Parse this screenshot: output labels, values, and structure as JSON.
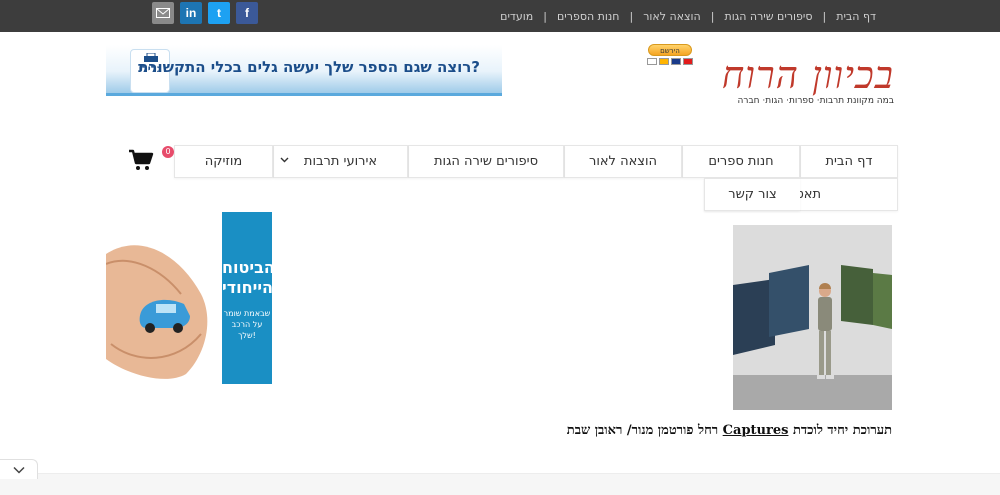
{
  "topbar": {
    "nav": [
      "דף הבית",
      "סיפורים שירה הגות",
      "הוצאה לאור",
      "חנות הספרים",
      "מועדים"
    ],
    "separator": "|",
    "social": {
      "mail_icon": "envelope-icon",
      "linkedin_label": "in",
      "twitter_label": "t",
      "facebook_label": "f",
      "colors": {
        "mail": "#8a8a8a",
        "linkedin": "#1d75b3",
        "twitter": "#1da1f2",
        "facebook": "#3b5998"
      }
    },
    "background": "#3d3d3d"
  },
  "header": {
    "logo_title": "בכיוון הרוח",
    "logo_subtitle": "במה מקוונת תרבות· ספרות· הגות· חברה",
    "logo_color": "#c0392b",
    "paypal_label": "הירשם",
    "banner_text": "רוצה שגם הספר שלך יעשה גלים בכלי התקשורת?",
    "banner_logo_text": "גלילי"
  },
  "mainnav": {
    "items": [
      "דף הבית",
      "חנות ספרים",
      "הוצאה לאור",
      "סיפורים שירה הגות",
      "אירועי תרבות",
      "מוזיקה",
      "תאטרון",
      "צור קשר"
    ],
    "dropdown_icon": "chevron-down-icon",
    "cart_icon": "shopping-cart-icon",
    "cart_count": "0"
  },
  "sidebar_ad": {
    "title_line1": "הביטוח",
    "title_line2": "הייחודי",
    "subtitle_line1": "שבאמת שומר",
    "subtitle_line2": "על הרכב שלך!",
    "color": "#1a8fc4"
  },
  "article": {
    "caption_prefix": "תערוכת יחיד  לוכדת ",
    "caption_link": "Captures",
    "caption_suffix": " רחל פורטמן מנור/ ראובן שבת"
  },
  "footer": {
    "scroll_icon": "chevron-down-icon"
  }
}
